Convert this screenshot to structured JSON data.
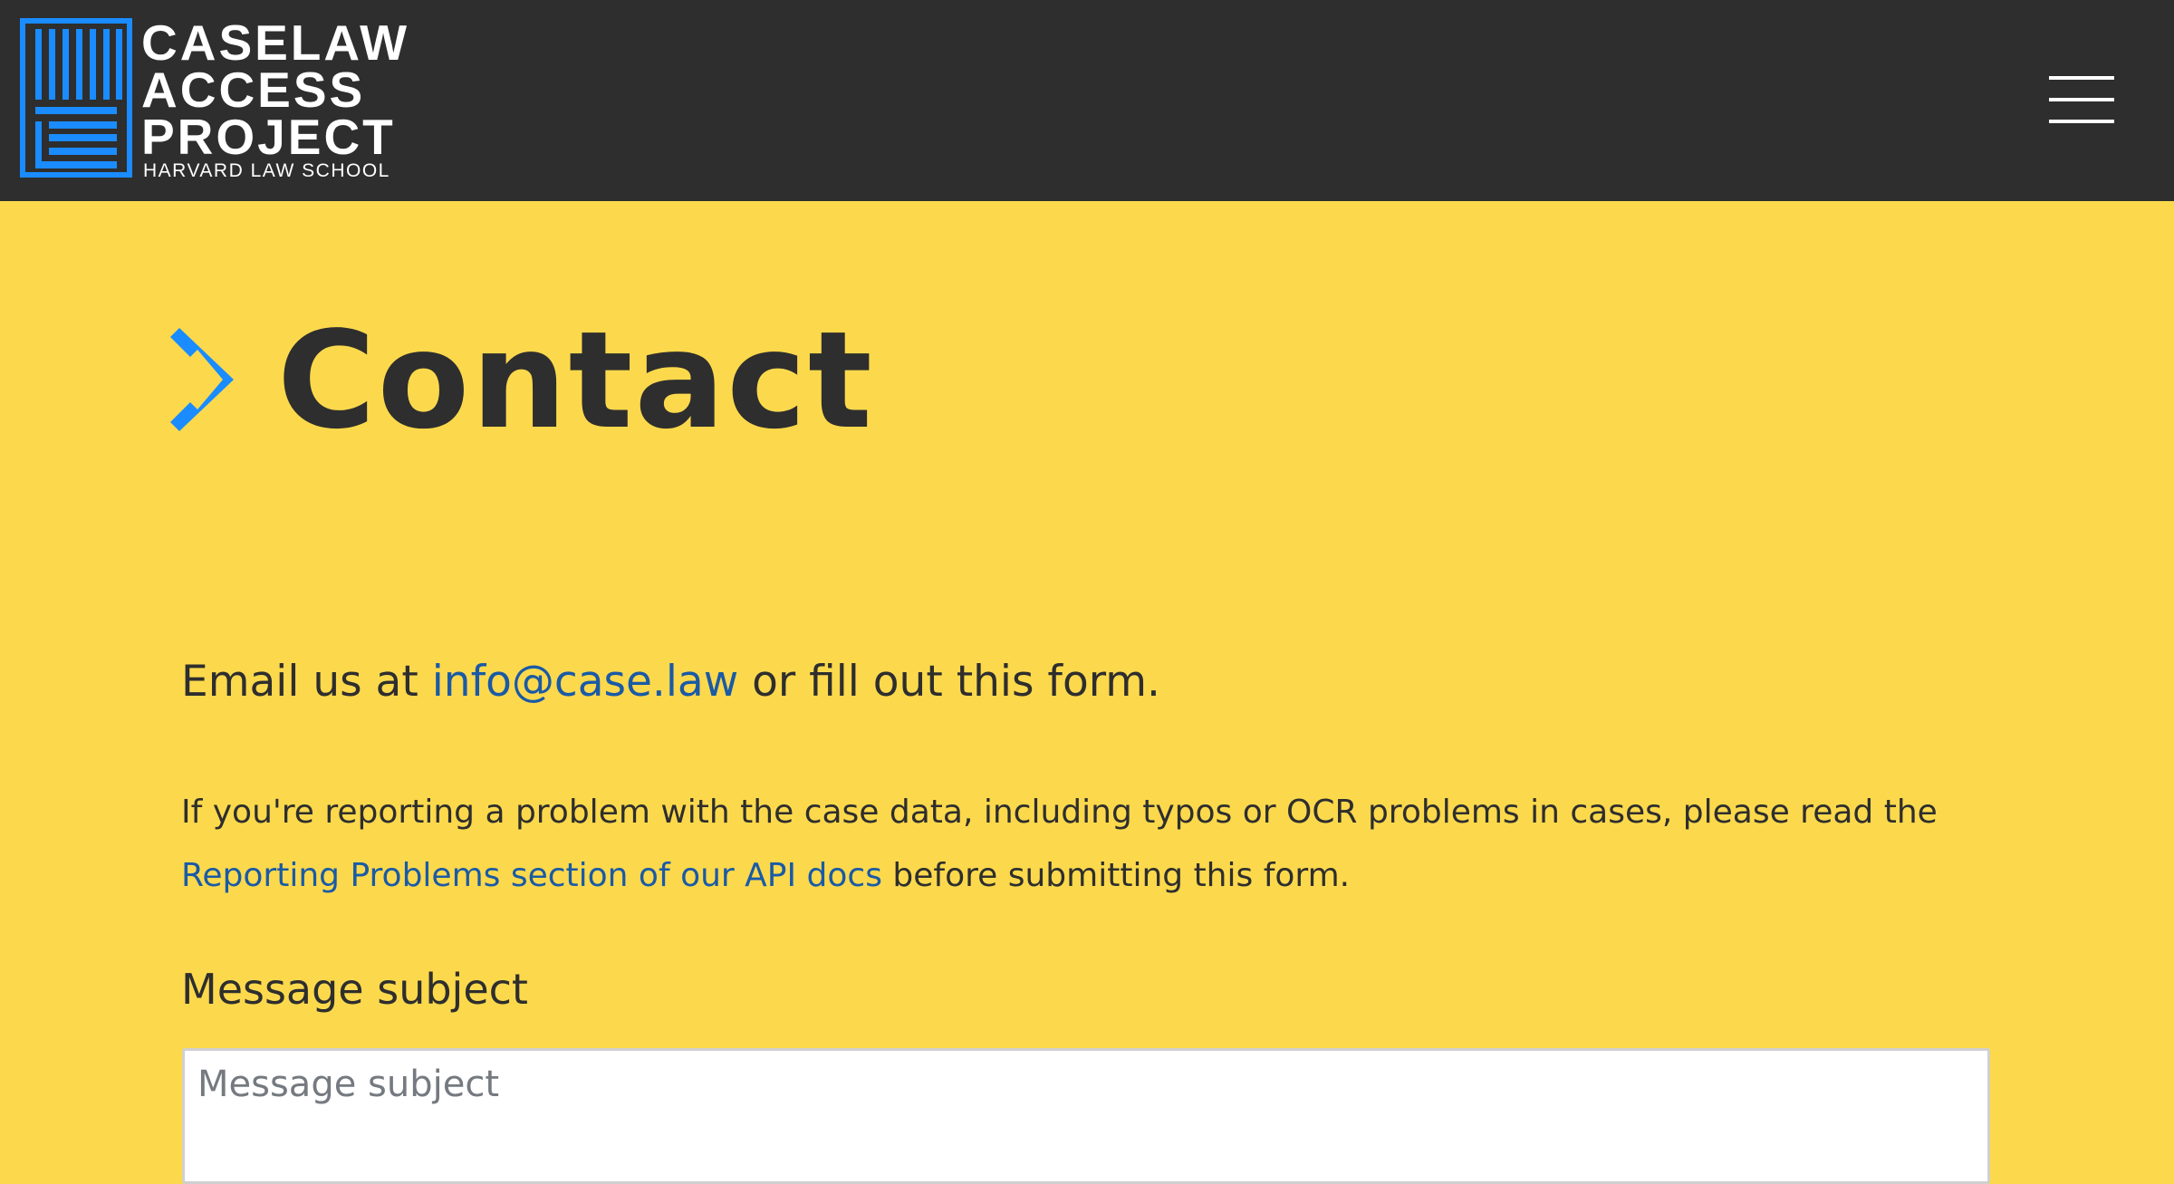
{
  "header": {
    "logo": {
      "line1": "CASELAW",
      "line2": "ACCESS",
      "line3": "PROJECT",
      "subtitle": "HARVARD LAW SCHOOL",
      "mark_icon": "grid-logo-icon"
    },
    "menu_icon": "hamburger-menu-icon"
  },
  "page": {
    "title": "Contact",
    "title_icon": "chevron-diamond-icon"
  },
  "intro": {
    "before": "Email us at ",
    "email_link": "info@case.law",
    "after": " or fill out this form."
  },
  "note": {
    "text_before": "If you're reporting a problem with the case data, including typos or OCR problems in cases, please read the ",
    "link": "Reporting Problems section of our API docs",
    "text_after": " before submitting this form."
  },
  "form": {
    "subject_label": "Message subject",
    "subject_value": "",
    "subject_placeholder": "Message subject"
  },
  "colors": {
    "header_bg": "#2e2e2e",
    "page_bg": "#fcd94c",
    "accent_blue": "#1a8cff",
    "link_blue": "#1a5aa6",
    "text": "#2e2e2e"
  }
}
